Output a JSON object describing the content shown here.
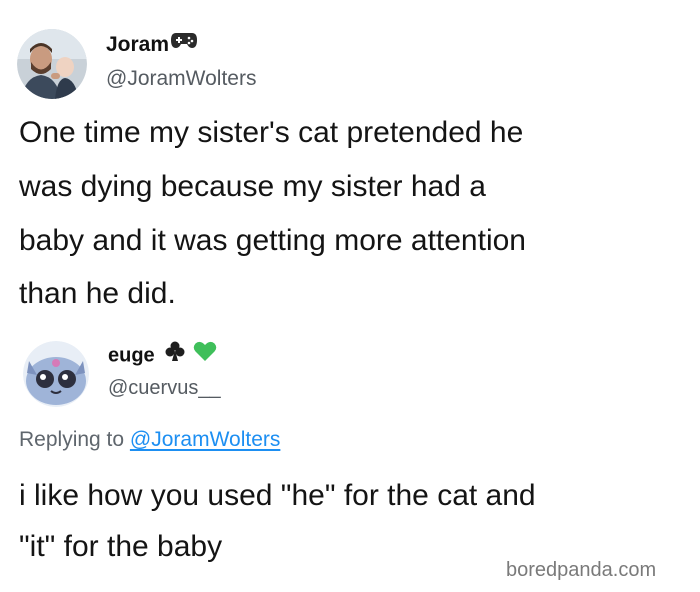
{
  "tweet": {
    "author_name": "Joram",
    "author_handle": "@JoramWolters",
    "name_emoji": "game-controller-icon",
    "text_lines": [
      "One time my sister's cat pretended he",
      "was dying because my sister had a",
      "baby and it was getting more attention",
      "than he did."
    ]
  },
  "reply": {
    "author_name": "euge",
    "author_handle": "@cuervus__",
    "name_emojis": [
      "club-suit-icon",
      "green-heart-icon"
    ],
    "replying_prefix": "Replying to",
    "replying_handle": "@JoramWolters",
    "text_lines": [
      "i like how you used \"he\" for the cat and",
      "\"it\" for the baby"
    ]
  },
  "watermark": "boredpanda.com",
  "colors": {
    "link": "#1d8ff2",
    "handle": "#555b61",
    "heart": "#3fbf5a"
  }
}
